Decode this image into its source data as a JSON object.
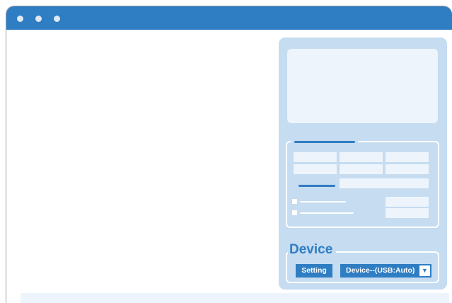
{
  "device": {
    "title": "Device",
    "setting_label": "Setting",
    "selected": "Device--(USB:Auto)",
    "arrow_icon": "▼"
  },
  "colors": {
    "accent": "#2f7dc2",
    "panel": "#c5dcf1",
    "field": "#eef4fb"
  }
}
